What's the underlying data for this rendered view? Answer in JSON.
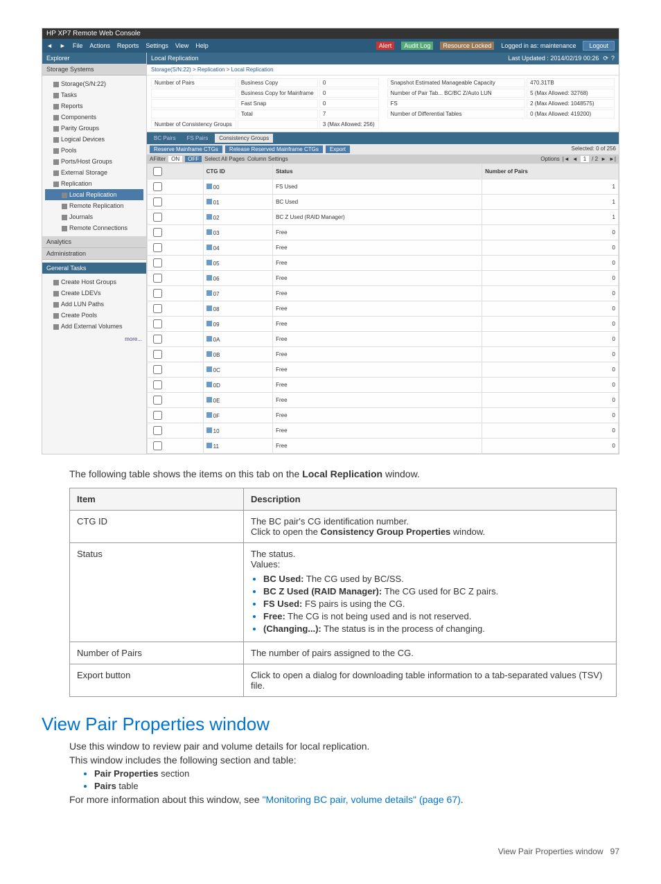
{
  "screenshot": {
    "titlebar": "HP XP7 Remote Web Console",
    "menu": [
      "File",
      "Actions",
      "Reports",
      "Settings",
      "View",
      "Help"
    ],
    "alerts_label": "Alert",
    "audit_label": "Audit Log",
    "resource_label": "Resource Locked",
    "login_status": "Logged in as: maintenance",
    "logout": "Logout",
    "explorer_header": "Explorer",
    "storage_systems_header": "Storage Systems",
    "tree": [
      "Storage(S/N:22)",
      "Tasks",
      "Reports",
      "Components",
      "Parity Groups",
      "Logical Devices",
      "Pools",
      "Ports/Host Groups",
      "External Storage",
      "Replication",
      "Local Replication",
      "Remote Replication",
      "Journals",
      "Remote Connections"
    ],
    "analytics_header": "Analytics",
    "admin_header": "Administration",
    "general_tasks_header": "General Tasks",
    "general_tasks": [
      "Create Host Groups",
      "Create LDEVs",
      "Add LUN Paths",
      "Create Pools",
      "Add External Volumes"
    ],
    "more": "more...",
    "panel_title": "Local Replication",
    "last_updated": "Last Updated : 2014/02/19 00:26",
    "breadcrumb": "Storage(S/N:22) > Replication > Local Replication",
    "stats_left": [
      {
        "k": "Number of Pairs",
        "k2": "Business Copy",
        "v": "0"
      },
      {
        "k": "",
        "k2": "Business Copy for Mainframe",
        "v": "0"
      },
      {
        "k": "",
        "k2": "Fast Snap",
        "v": "0"
      },
      {
        "k": "",
        "k2": "Total",
        "v": "7"
      },
      {
        "k": "Number of Consistency Groups",
        "k2": "",
        "v": "3 (Max Allowed: 256)"
      }
    ],
    "stats_right": [
      {
        "k": "Snapshot Estimated Manageable Capacity",
        "v": "470.31TB"
      },
      {
        "k": "Number of Pair Tab...  BC/BC Z/Auto LUN",
        "v": "5 (Max Allowed: 32768)"
      },
      {
        "k": "FS",
        "v": "2 (Max Allowed: 1048575)"
      },
      {
        "k": "Number of Differential Tables",
        "v": "0 (Max Allowed: 419200)"
      }
    ],
    "subtabs": [
      "BC Pairs",
      "FS Pairs",
      "Consistency Groups"
    ],
    "toolbar_buttons": [
      "Reserve Mainframe CTGs",
      "Release Reserved Mainframe CTGs",
      "Export"
    ],
    "selected_label": "Selected: 0  of 256",
    "filter_label": "AFilter",
    "on_label": "ON",
    "off_label": "OFF",
    "select_all_label": "Select All Pages",
    "column_settings_label": "Column Settings",
    "options_label": "Options",
    "page_val": "1",
    "page_total": "/ 2",
    "columns": [
      "",
      "CTG ID",
      "Status",
      "Number of Pairs"
    ],
    "rows": [
      {
        "id": "00",
        "status": "FS Used",
        "pairs": "1"
      },
      {
        "id": "01",
        "status": "BC Used",
        "pairs": "1"
      },
      {
        "id": "02",
        "status": "BC Z Used (RAID Manager)",
        "pairs": "1"
      },
      {
        "id": "03",
        "status": "Free",
        "pairs": "0"
      },
      {
        "id": "04",
        "status": "Free",
        "pairs": "0"
      },
      {
        "id": "05",
        "status": "Free",
        "pairs": "0"
      },
      {
        "id": "06",
        "status": "Free",
        "pairs": "0"
      },
      {
        "id": "07",
        "status": "Free",
        "pairs": "0"
      },
      {
        "id": "08",
        "status": "Free",
        "pairs": "0"
      },
      {
        "id": "09",
        "status": "Free",
        "pairs": "0"
      },
      {
        "id": "0A",
        "status": "Free",
        "pairs": "0"
      },
      {
        "id": "0B",
        "status": "Free",
        "pairs": "0"
      },
      {
        "id": "0C",
        "status": "Free",
        "pairs": "0"
      },
      {
        "id": "0D",
        "status": "Free",
        "pairs": "0"
      },
      {
        "id": "0E",
        "status": "Free",
        "pairs": "0"
      },
      {
        "id": "0F",
        "status": "Free",
        "pairs": "0"
      },
      {
        "id": "10",
        "status": "Free",
        "pairs": "0"
      },
      {
        "id": "11",
        "status": "Free",
        "pairs": "0"
      }
    ]
  },
  "caption_before": "The following table shows the items on this tab on the ",
  "caption_bold": "Local Replication",
  "caption_after": " window.",
  "table": {
    "headers": {
      "item": "Item",
      "desc": "Description"
    },
    "rows": {
      "ctg": {
        "item": "CTG ID",
        "line1": "The BC pair's CG identification number.",
        "line2a": "Click to open the ",
        "line2b": "Consistency Group Properties",
        "line2c": " window."
      },
      "status": {
        "item": "Status",
        "line1": "The status.",
        "line2": "Values:",
        "b1a": "BC Used:",
        "b1b": " The CG used by BC/SS.",
        "b2a": "BC Z Used (RAID Manager):",
        "b2b": " The CG used for BC Z pairs.",
        "b3a": "FS Used:",
        "b3b": " FS pairs is using the CG.",
        "b4a": "Free:",
        "b4b": " The CG is not being used and is not reserved.",
        "b5a": "(Changing...):",
        "b5b": " The status is in the process of changing."
      },
      "pairs": {
        "item": "Number of Pairs",
        "desc": "The number of pairs assigned to the CG."
      },
      "export": {
        "item": "Export button",
        "desc": "Click to open a dialog for downloading table information to a tab-separated values (TSV) file."
      }
    }
  },
  "h2": "View Pair Properties window",
  "p1": "Use this window to review pair and volume details for local replication.",
  "p2": "This window includes the following section and table:",
  "bul": {
    "a1": "Pair Properties",
    "a2": " section",
    "b1": "Pairs",
    "b2": " table"
  },
  "p3a": "For more information about this window, see ",
  "p3link": "\"Monitoring BC pair, volume details\" (page 67)",
  "p3b": ".",
  "footer_label": "View Pair Properties window",
  "footer_page": "97"
}
